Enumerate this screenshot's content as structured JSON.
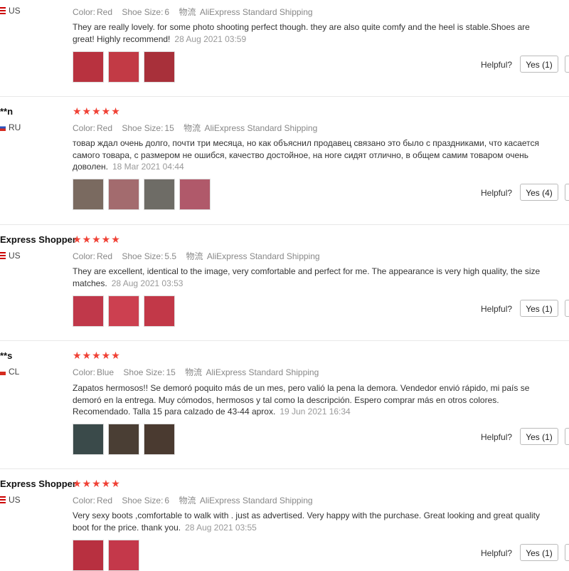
{
  "reviews": [
    {
      "user": "",
      "country": "US",
      "color_label": "Color:",
      "color": "Red",
      "size_label": "Shoe Size:",
      "size": "6",
      "shipping_label": "物流",
      "shipping": "AliExpress Standard Shipping",
      "text": "They are really lovely. for some photo shooting perfect though. they are also quite comfy and the heel is stable.Shoes are great! Highly recommend!",
      "date": "28 Aug 2021 03:59",
      "helpful_label": "Helpful?",
      "yes": "Yes (1)",
      "thumb_colors": [
        "#b8323f",
        "#c23a45",
        "#a8303a"
      ]
    },
    {
      "user": "**n",
      "country": "RU",
      "stars": "★★★★★",
      "color_label": "Color:",
      "color": "Red",
      "size_label": "Shoe Size:",
      "size": "15",
      "shipping_label": "物流",
      "shipping": "AliExpress Standard Shipping",
      "text": "товар ждал очень долго, почти три месяца, но как объяснил продавец связано это было с праздниками, что касается самого товара, с размером не ошибся, качество достойное, на ноге сидят отлично, в общем самим товаром очень доволен.",
      "date": "18 Mar 2021 04:44",
      "helpful_label": "Helpful?",
      "yes": "Yes (4)",
      "thumb_colors": [
        "#7a6a60",
        "#a36b6e",
        "#6e6c66",
        "#b0596a"
      ]
    },
    {
      "user": "Express Shopper",
      "country": "US",
      "stars": "★★★★★",
      "color_label": "Color:",
      "color": "Red",
      "size_label": "Shoe Size:",
      "size": "5.5",
      "shipping_label": "物流",
      "shipping": "AliExpress Standard Shipping",
      "text": "They are excellent, identical to the image, very comfortable and perfect for me. The appearance is very high quality, the size matches.",
      "date": "28 Aug 2021 03:53",
      "helpful_label": "Helpful?",
      "yes": "Yes (1)",
      "thumb_colors": [
        "#c0384a",
        "#cc4050",
        "#c23848"
      ]
    },
    {
      "user": "**s",
      "country": "CL",
      "stars": "★★★★★",
      "color_label": "Color:",
      "color": "Blue",
      "size_label": "Shoe Size:",
      "size": "15",
      "shipping_label": "物流",
      "shipping": "AliExpress Standard Shipping",
      "text": "Zapatos hermosos!! Se demoró poquito más de un mes, pero valió la pena la demora. Vendedor envió rápido, mi país se demoró en la entrega. Muy cómodos, hermosos y tal como la descripción. Espero comprar más en otros colores. Recomendado. Talla 15 para calzado de 43-44 aprox.",
      "date": "19 Jun 2021 16:34",
      "helpful_label": "Helpful?",
      "yes": "Yes (1)",
      "thumb_colors": [
        "#3a4a4a",
        "#4a3e34",
        "#4a3a30"
      ]
    },
    {
      "user": "Express Shopper",
      "country": "US",
      "stars": "★★★★★",
      "color_label": "Color:",
      "color": "Red",
      "size_label": "Shoe Size:",
      "size": "6",
      "shipping_label": "物流",
      "shipping": "AliExpress Standard Shipping",
      "text": "Very sexy boots ,comfortable to walk with . just as advertised. Very happy with the purchase. Great looking and great quality boot for the price. thank you.",
      "date": "28 Aug 2021 03:55",
      "helpful_label": "Helpful?",
      "yes": "Yes (1)",
      "thumb_colors": [
        "#b83040",
        "#c4384a"
      ]
    }
  ]
}
